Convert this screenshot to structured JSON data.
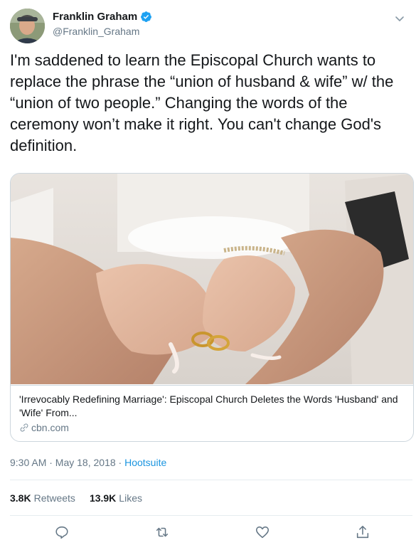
{
  "author": {
    "name": "Franklin Graham",
    "handle": "@Franklin_Graham",
    "verified": true,
    "avatar_icon": "profile-photo"
  },
  "tweet": {
    "text": "I'm saddened to learn the Episcopal Church wants to replace the phrase the “union of husband & wife” w/ the “union of two people.” Changing the words of the ceremony won’t make it right. You can't change God's definition."
  },
  "card": {
    "image_icon": "hands-holding-wedding-rings-photo",
    "title": "'Irrevocably Redefining Marriage': Episcopal Church Deletes the Words 'Husband' and 'Wife' From...",
    "domain": "cbn.com"
  },
  "meta": {
    "time": "9:30 AM · May 18, 2018 · ",
    "source": "Hootsuite"
  },
  "stats": {
    "retweets_count": "3.8K",
    "retweets_label": "Retweets",
    "likes_count": "13.9K",
    "likes_label": "Likes"
  },
  "colors": {
    "link": "#1b95e0",
    "secondary_text": "#657786",
    "verified": "#1da1f2"
  }
}
